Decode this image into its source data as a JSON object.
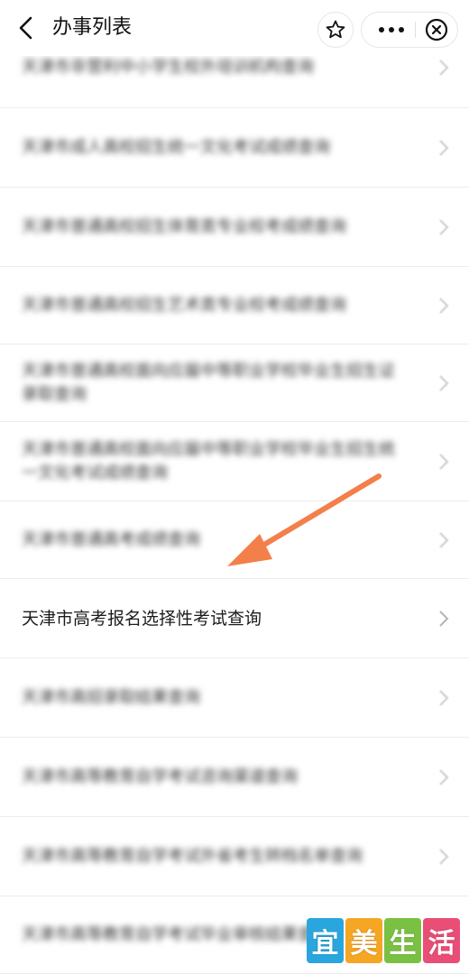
{
  "header": {
    "title": "办事列表"
  },
  "items": [
    {
      "label": "天津市非营利中小学生校外培训机构查询"
    },
    {
      "label": "天津市成人高校招生统一文化考试成绩查询"
    },
    {
      "label": "天津市普通高校招生体育类专业校考成绩查询"
    },
    {
      "label": "天津市普通高校招生艺术类专业校考成绩查询"
    },
    {
      "label": "天津市普通高校面向应届中等职业学校毕业生招生证录取查询"
    },
    {
      "label": "天津市普通高校面向应届中等职业学校毕业生招生统一文化考试成绩查询"
    },
    {
      "label": "天津市普通高考成绩查询"
    },
    {
      "label": "天津市高考报名选择性考试查询"
    },
    {
      "label": "天津市高招录取结果查询"
    },
    {
      "label": "天津市高等教育自学考试咨询渠道查询"
    },
    {
      "label": "天津市高等教育自学考试外省考生转档名单查询"
    },
    {
      "label": "天津市高等教育自学考试毕业审核结果查询"
    }
  ],
  "watermark": {
    "chars": [
      "宜",
      "美",
      "生",
      "活"
    ],
    "colors": [
      "#2aa6de",
      "#f5a623",
      "#7ac143",
      "#e94e77"
    ]
  }
}
